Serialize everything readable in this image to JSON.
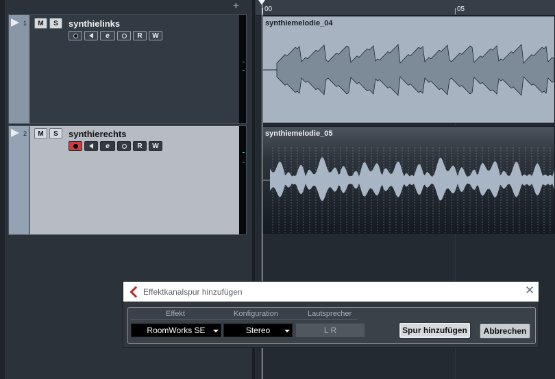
{
  "toolbar": {
    "add_track_symbol": "+"
  },
  "tracks": [
    {
      "number": "1",
      "name": "synthielinks",
      "mute_label": "M",
      "solo_label": "S",
      "edit_label": "e",
      "read_label": "R",
      "write_label": "W",
      "record_armed": false,
      "selected": false
    },
    {
      "number": "2",
      "name": "synthierechts",
      "mute_label": "M",
      "solo_label": "S",
      "edit_label": "e",
      "read_label": "R",
      "write_label": "W",
      "record_armed": true,
      "selected": true
    }
  ],
  "ruler": {
    "marks": [
      "00",
      "05"
    ]
  },
  "events": [
    {
      "name": "synthiemelodie_04"
    },
    {
      "name": "synthiemelodie_05"
    }
  ],
  "dialog": {
    "title": "Effektkanalspur hinzufügen",
    "close_symbol": "✕",
    "columns": {
      "effect_header": "Effekt",
      "config_header": "Konfiguration",
      "speaker_header": "Lautsprecher"
    },
    "effect_value": "RoomWorks SE",
    "config_value": "Stereo",
    "speaker_value": "L R",
    "add_button": "Spur hinzufügen",
    "cancel_button": "Abbrechen"
  },
  "colors": {
    "record_armed": "#cf3c40",
    "selected_track": "#b6bcc2",
    "logo_red": "#c4262b"
  }
}
